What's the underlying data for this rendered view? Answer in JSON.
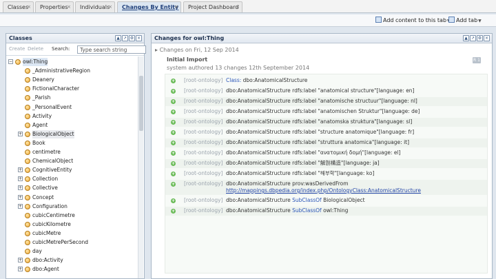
{
  "tabs": [
    {
      "label": "Classes",
      "active": false
    },
    {
      "label": "Properties",
      "active": false
    },
    {
      "label": "Individuals",
      "active": false
    },
    {
      "label": "Changes By Entity",
      "active": true
    },
    {
      "label": "Project Dashboard",
      "active": false
    }
  ],
  "tab_close_glyph": "×",
  "toolbar": {
    "add_content": "Add content to this tab",
    "add_tab": "Add tab"
  },
  "classes_panel": {
    "title": "Classes",
    "create_label": "Create",
    "delete_label": "Delete",
    "search_label": "Search:",
    "search_placeholder": "Type search string",
    "tree": [
      {
        "label": "owl:Thing",
        "level": 0,
        "expander": "−",
        "selected": true
      },
      {
        "label": "_AdministrativeRegion",
        "level": 1,
        "expander": ""
      },
      {
        "label": "Deanery",
        "level": 1,
        "expander": ""
      },
      {
        "label": "FictionalCharacter",
        "level": 1,
        "expander": ""
      },
      {
        "label": "_Parish",
        "level": 1,
        "expander": ""
      },
      {
        "label": "_PersonalEvent",
        "level": 1,
        "expander": ""
      },
      {
        "label": "Activity",
        "level": 1,
        "expander": ""
      },
      {
        "label": "Agent",
        "level": 1,
        "expander": ""
      },
      {
        "label": "BiologicalObject",
        "level": 1,
        "expander": "+",
        "hl": true
      },
      {
        "label": "Book",
        "level": 1,
        "expander": ""
      },
      {
        "label": "centimetre",
        "level": 1,
        "expander": ""
      },
      {
        "label": "ChemicalObject",
        "level": 1,
        "expander": ""
      },
      {
        "label": "CognitiveEntity",
        "level": 1,
        "expander": "+"
      },
      {
        "label": "Collection",
        "level": 1,
        "expander": "+"
      },
      {
        "label": "Collective",
        "level": 1,
        "expander": "+"
      },
      {
        "label": "Concept",
        "level": 1,
        "expander": "+"
      },
      {
        "label": "Configuration",
        "level": 1,
        "expander": "+"
      },
      {
        "label": "cubicCentimetre",
        "level": 1,
        "expander": ""
      },
      {
        "label": "cubicKilometre",
        "level": 1,
        "expander": ""
      },
      {
        "label": "cubicMetre",
        "level": 1,
        "expander": ""
      },
      {
        "label": "cubicMetrePerSecond",
        "level": 1,
        "expander": ""
      },
      {
        "label": "day",
        "level": 1,
        "expander": ""
      },
      {
        "label": "dbo:Activity",
        "level": 1,
        "expander": "+"
      },
      {
        "label": "dbo:Agent",
        "level": 1,
        "expander": "+"
      }
    ]
  },
  "changes_panel": {
    "title": "Changes for owl:Thing",
    "date_line": "Changes on Fri, 12 Sep 2014",
    "import_title": "Initial Import",
    "import_sub": "system authored 13 changes 12th September 2014",
    "badge": "R 1",
    "ontology_label": "[root-ontology]",
    "rows": [
      {
        "subject": "Class: ",
        "subject_kw": true,
        "rest": "dbo:AnatomicalStructure",
        "alt": false
      },
      {
        "subject": "dbo:AnatomicalStructure ",
        "pred": "rdfs:label ",
        "lit": "\"anatomical structure\"",
        "tail": "[language: en]",
        "alt": false
      },
      {
        "subject": "dbo:AnatomicalStructure ",
        "pred": "rdfs:label ",
        "lit": "\"anatomische structuur\"",
        "tail": "[language: nl]",
        "alt": true
      },
      {
        "subject": "dbo:AnatomicalStructure ",
        "pred": "rdfs:label ",
        "lit": "\"anatomischen Struktur\"",
        "tail": "[language: de]",
        "alt": false
      },
      {
        "subject": "dbo:AnatomicalStructure ",
        "pred": "rdfs:label ",
        "lit": "\"anatomska struktura\"",
        "tail": "[language: sl]",
        "alt": true
      },
      {
        "subject": "dbo:AnatomicalStructure ",
        "pred": "rdfs:label ",
        "lit": "\"structure anatomique\"",
        "tail": "[language: fr]",
        "alt": false
      },
      {
        "subject": "dbo:AnatomicalStructure ",
        "pred": "rdfs:label ",
        "lit": "\"struttura anatomica\"",
        "tail": "[language: it]",
        "alt": true
      },
      {
        "subject": "dbo:AnatomicalStructure ",
        "pred": "rdfs:label ",
        "lit": "\"ανατομική δομή\"",
        "tail": "[language: el]",
        "alt": false
      },
      {
        "subject": "dbo:AnatomicalStructure ",
        "pred": "rdfs:label ",
        "lit": "\"解剖構造\"",
        "tail": "[language: ja]",
        "alt": true
      },
      {
        "subject": "dbo:AnatomicalStructure ",
        "pred": "rdfs:label ",
        "lit": "\"해부학\"",
        "tail": "[language: ko]",
        "alt": false
      },
      {
        "subject": "dbo:AnatomicalStructure ",
        "pred": "prov:wasDerivedFrom ",
        "lit": "",
        "tail": "",
        "link": "http://mappings.dbpedia.org/index.php/OntologyClass:AnatomicalStructure",
        "alt": true
      },
      {
        "subject": "dbo:AnatomicalStructure ",
        "pred": "SubClassOf ",
        "pred_kw": true,
        "lit": "BiologicalObject",
        "tail": "",
        "alt": false
      },
      {
        "subject": "dbo:AnatomicalStructure ",
        "pred": "SubClassOf ",
        "pred_kw": true,
        "lit": "owl:Thing",
        "tail": "",
        "alt": true
      }
    ]
  }
}
